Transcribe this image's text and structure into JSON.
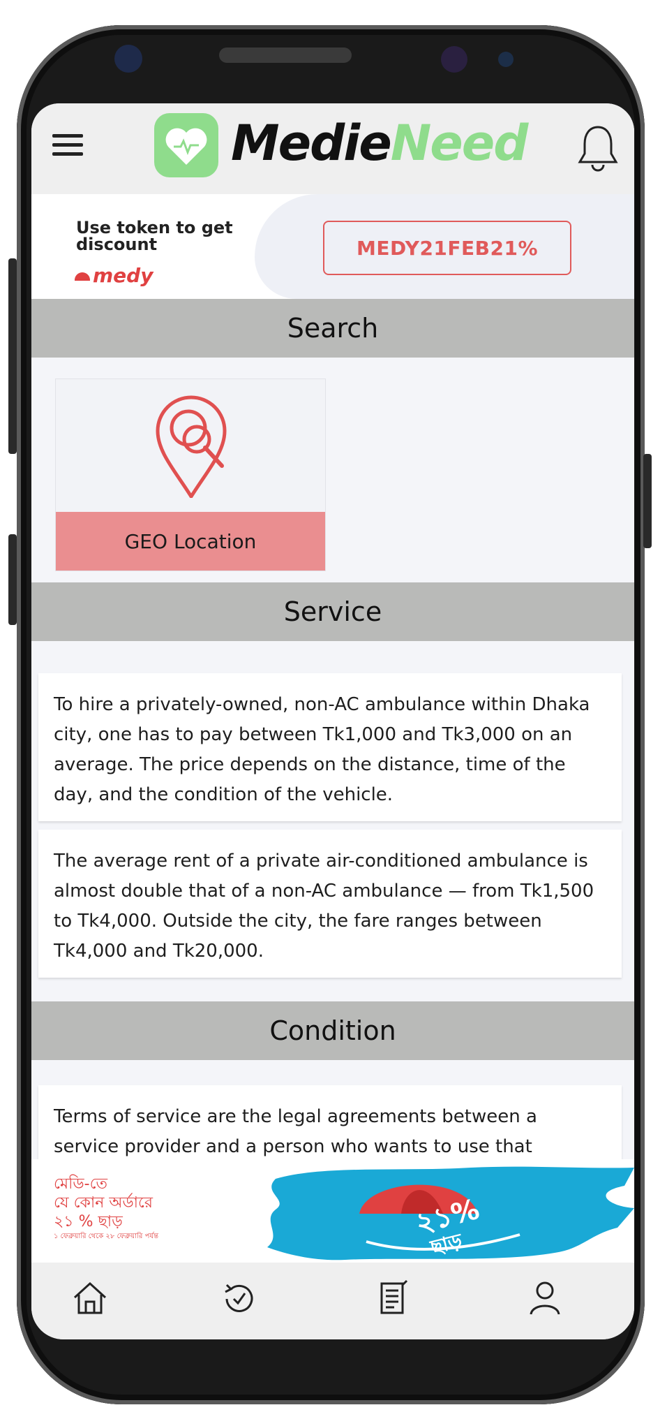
{
  "header": {
    "logo_part1": "Medie",
    "logo_part2": "Need",
    "menu_icon": "hamburger-menu-icon",
    "bell_icon": "notification-bell-icon",
    "brand_green": "#8fdc8c"
  },
  "promo": {
    "title": "Use token to get discount",
    "brand": "medy",
    "token_code": "MEDY21FEB21%",
    "accent": "#e05a5a"
  },
  "sections": {
    "search": "Search",
    "service": "Service",
    "condition": "Condition"
  },
  "geo": {
    "label": "GEO Location",
    "icon": "location-search-icon",
    "label_bg": "#ea8e90"
  },
  "service": {
    "paragraph1": "To hire a privately-owned, non-AC ambulance within Dhaka city, one has to pay between Tk1,000 and Tk3,000 on an average. The price depends on the distance, time of the day, and the condition of the vehicle.",
    "paragraph2": "The average rent of a private air-conditioned ambulance is almost double that of a non-AC ambulance — from Tk1,500 to Tk4,000. Outside the city, the fare ranges between Tk4,000 and Tk20,000."
  },
  "condition": {
    "paragraph1": "Terms of service are the legal agreements between a service provider and a person who wants to use that"
  },
  "bottom_banner": {
    "line1": "মেডি-তে",
    "line2": "যে কোন অর্ডারে",
    "line3": "২১ % ছাড়",
    "line4": "১ ফেব্রুয়ারি থেকে ২৮ ফেব্রুয়ারি পর্যন্ত",
    "badge_number": "২১%",
    "badge_text": "ছাড়"
  },
  "bottom_nav": {
    "items": [
      "home-icon",
      "history-icon",
      "orders-icon",
      "profile-icon"
    ]
  }
}
